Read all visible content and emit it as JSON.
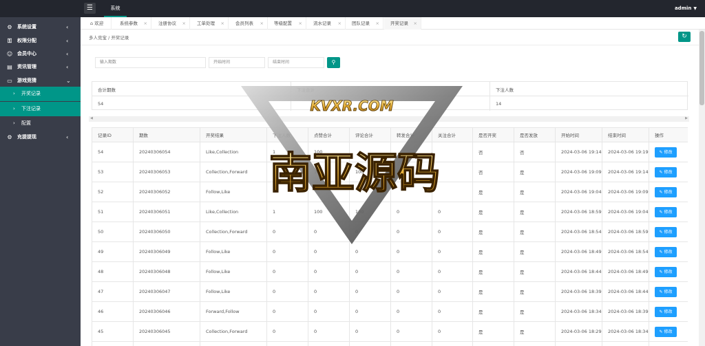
{
  "topbar": {
    "menu_icon": "hamburger-icon",
    "module_tab": "系统",
    "user": "admin",
    "user_caret": "▼"
  },
  "sidebar": {
    "items": [
      {
        "icon": "gear-icon",
        "glyph": "⚙",
        "label": "系统设置",
        "chev": "‹"
      },
      {
        "icon": "key-icon",
        "glyph": "⚿",
        "label": "权限分配",
        "chev": "‹"
      },
      {
        "icon": "user-icon",
        "glyph": "☺",
        "label": "会员中心",
        "chev": "‹"
      },
      {
        "icon": "news-icon",
        "glyph": "▤",
        "label": "资讯管理",
        "chev": "‹"
      },
      {
        "icon": "monitor-icon",
        "glyph": "▭",
        "label": "游戏竞猜",
        "chev": "⌄"
      }
    ],
    "sub_items": [
      {
        "arrow": "›",
        "label": "开奖记录",
        "active": true
      },
      {
        "arrow": "›",
        "label": "下注记录",
        "active": true
      },
      {
        "arrow": "›",
        "label": "配置",
        "active": false
      }
    ],
    "last_item": {
      "icon": "gear-icon",
      "glyph": "⚙",
      "label": "充提提现",
      "chev": "‹"
    }
  },
  "tabs": [
    {
      "label": "⌂ 欢迎",
      "close": ""
    },
    {
      "label": "系统参数",
      "close": "×"
    },
    {
      "label": "注册协议",
      "close": "×"
    },
    {
      "label": "工单处理",
      "close": "×"
    },
    {
      "label": "会员列表",
      "close": "×"
    },
    {
      "label": "等级配置",
      "close": "×"
    },
    {
      "label": "流水记录",
      "close": "×"
    },
    {
      "label": "团队记录",
      "close": "×"
    },
    {
      "label": "开奖记录",
      "close": "×"
    }
  ],
  "breadcrumb": "多人竞宝  /  开奖记录",
  "refresh_icon": "refresh-icon",
  "filters": {
    "issue_placeholder": "输入期数",
    "start_placeholder": "开始时间",
    "end_placeholder": "结束时间",
    "search_icon": "search-icon"
  },
  "summary": {
    "headers": [
      "合计期数",
      "下注合计",
      "下注人数"
    ],
    "values": [
      "54",
      "",
      "14"
    ]
  },
  "table": {
    "columns": [
      "记录ID",
      "期数",
      "开奖结果",
      "下注人数",
      "点赞合计",
      "评论合计",
      "转发合计",
      "关注合计",
      "是否开奖",
      "是否发放",
      "开始时间",
      "结束时间",
      "操作"
    ],
    "edit_label": "修改",
    "rows": [
      [
        "54",
        "20240306054",
        "Like,Collection",
        "1",
        "100",
        "",
        "",
        "",
        "否",
        "否",
        "2024-03-06 19:14",
        "2024-03-06 19:19"
      ],
      [
        "53",
        "20240306053",
        "Collection,Forward",
        "1",
        "100",
        "100",
        "100",
        "",
        "否",
        "是",
        "2024-03-06 19:09",
        "2024-03-06 19:14"
      ],
      [
        "52",
        "20240306052",
        "Follow,Like",
        "",
        "",
        "",
        "",
        "",
        "是",
        "是",
        "2024-03-06 19:04",
        "2024-03-06 19:09"
      ],
      [
        "51",
        "20240306051",
        "Like,Collection",
        "1",
        "100",
        "100",
        "0",
        "0",
        "是",
        "是",
        "2024-03-06 18:59",
        "2024-03-06 19:04"
      ],
      [
        "50",
        "20240306050",
        "Collection,Forward",
        "0",
        "0",
        "0",
        "0",
        "0",
        "是",
        "是",
        "2024-03-06 18:54",
        "2024-03-06 18:59"
      ],
      [
        "49",
        "20240306049",
        "Follow,Like",
        "0",
        "0",
        "0",
        "0",
        "0",
        "是",
        "是",
        "2024-03-06 18:49",
        "2024-03-06 18:54"
      ],
      [
        "48",
        "20240306048",
        "Follow,Like",
        "0",
        "0",
        "0",
        "0",
        "0",
        "是",
        "是",
        "2024-03-06 18:44",
        "2024-03-06 18:49"
      ],
      [
        "47",
        "20240306047",
        "Follow,Like",
        "0",
        "0",
        "0",
        "0",
        "0",
        "是",
        "是",
        "2024-03-06 18:39",
        "2024-03-06 18:44"
      ],
      [
        "46",
        "20240306046",
        "Forward,Follow",
        "0",
        "0",
        "0",
        "0",
        "0",
        "是",
        "是",
        "2024-03-06 18:34",
        "2024-03-06 18:39"
      ],
      [
        "45",
        "20240306045",
        "Collection,Forward",
        "0",
        "0",
        "0",
        "0",
        "0",
        "是",
        "是",
        "2024-03-06 18:29",
        "2024-03-06 18:34"
      ],
      [
        "44",
        "20240306044",
        "",
        "",
        "",
        "",
        "",
        "",
        "",
        "",
        "",
        ""
      ]
    ]
  },
  "watermark": {
    "line1": "KVXR.COM",
    "line2": "南亚源码"
  },
  "colors": {
    "accent": "#009688",
    "edit": "#1e9fff",
    "dark": "#23262e",
    "side": "#393d49"
  }
}
